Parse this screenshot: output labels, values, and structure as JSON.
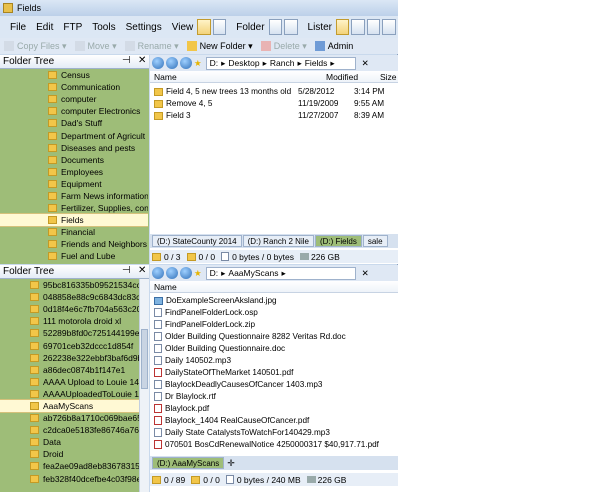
{
  "window": {
    "title": "Fields"
  },
  "menu": [
    "File",
    "Edit",
    "FTP",
    "Tools",
    "Settings",
    "View",
    "Folder",
    "Lister"
  ],
  "toolbar2": {
    "copy": "Copy Files",
    "move": "Move",
    "rename": "Rename",
    "new_folder": "New Folder",
    "delete": "Delete",
    "admin": "Admin"
  },
  "top_tree": {
    "title": "Folder Tree",
    "items": [
      "Census",
      "Communication",
      "computer",
      "computer Electronics",
      "Dad's Stuff",
      "Department of Agricult",
      "Diseases and pests",
      "Documents",
      "Employees",
      "Equipment",
      "Farm News information",
      "Fertilizer, Supplies, con",
      "Fields",
      "Financial",
      "Friends and Neighbors",
      "Fuel and Lube"
    ],
    "selected": "Fields"
  },
  "top_lister": {
    "path": [
      "D:",
      "Desktop",
      "Ranch",
      "Fields"
    ],
    "columns": {
      "name": "Name",
      "modified": "Modified",
      "size": "Size"
    },
    "rows": [
      {
        "name": "Field 4, 5 new trees 13 months old",
        "date": "5/28/2012",
        "time": "3:14 PM"
      },
      {
        "name": "Remove 4, 5",
        "date": "11/19/2009",
        "time": "9:55 AM"
      },
      {
        "name": "Field 3",
        "date": "11/27/2007",
        "time": "8:39 AM"
      }
    ],
    "tabs": [
      "(D:) StateCounty 2014",
      "(D:) Ranch 2 Nile",
      "(D:) Fields",
      "sale"
    ],
    "active_tab": "(D:) Fields",
    "status": {
      "count": "0 / 3",
      "folders": "0 / 0",
      "bytes": "0 bytes / 0 bytes",
      "free": "226 GB"
    }
  },
  "bottom_tree": {
    "title": "Folder Tree",
    "items": [
      "95bc816335b09521534cc30f",
      "048858e88c9c6843dc83c94",
      "0d18f4e6c7fb704a563c2048",
      "111 motorola droid xl",
      "52289b8fd0c725144199e5",
      "69701ceb32dccc1d854f",
      "262238e322ebbf3baf6d9b3",
      "a86dec0874b1f147e1",
      "AAAA Upload to Louie 1404",
      "AAAAUploadedToLouie 140",
      "AaaMyScans",
      "ab726b8a1710c069bae657b",
      "c2dca0e5183fe86746a76a",
      "Data",
      "Droid",
      "fea2ae09ad8eb8367831529",
      "feb328f40dcefbe4c03f98ec5"
    ],
    "selected": "AaaMyScans"
  },
  "bottom_lister": {
    "path": [
      "D:",
      "AaaMyScans"
    ],
    "columns": {
      "name": "Name"
    },
    "rows": [
      {
        "name": "DoExampleScreenAksland.jpg",
        "type": "img"
      },
      {
        "name": "FindPanelFolderLock.osp",
        "type": "doc"
      },
      {
        "name": "FindPanelFolderLock.zip",
        "type": "doc"
      },
      {
        "name": "Older Building Questionnaire 8282 Veritas Rd.doc",
        "type": "doc"
      },
      {
        "name": "Older Building Questionnaire.doc",
        "type": "doc"
      },
      {
        "name": "Daily 140502.mp3",
        "type": "doc"
      },
      {
        "name": "DailyStateOfTheMarket 140501.pdf",
        "type": "pdf"
      },
      {
        "name": "BlaylockDeadlyCausesOfCancer 1403.mp3",
        "type": "doc"
      },
      {
        "name": "Dr Blaylock.rtf",
        "type": "doc"
      },
      {
        "name": "Blaylock.pdf",
        "type": "pdf"
      },
      {
        "name": "Blaylock_1404 RealCauseOfCancer.pdf",
        "type": "pdf"
      },
      {
        "name": "Daily State CatalystsToWatchFor140429.mp3",
        "type": "doc"
      },
      {
        "name": "070501 BosCdRenewalNotice 4250000317 $40,917.71.pdf",
        "type": "pdf"
      }
    ],
    "tabs": [
      "(D:) AaaMyScans"
    ],
    "status": {
      "count": "0 / 89",
      "folders": "0 / 0",
      "bytes": "0 bytes / 240 MB",
      "free": "226 GB"
    }
  }
}
